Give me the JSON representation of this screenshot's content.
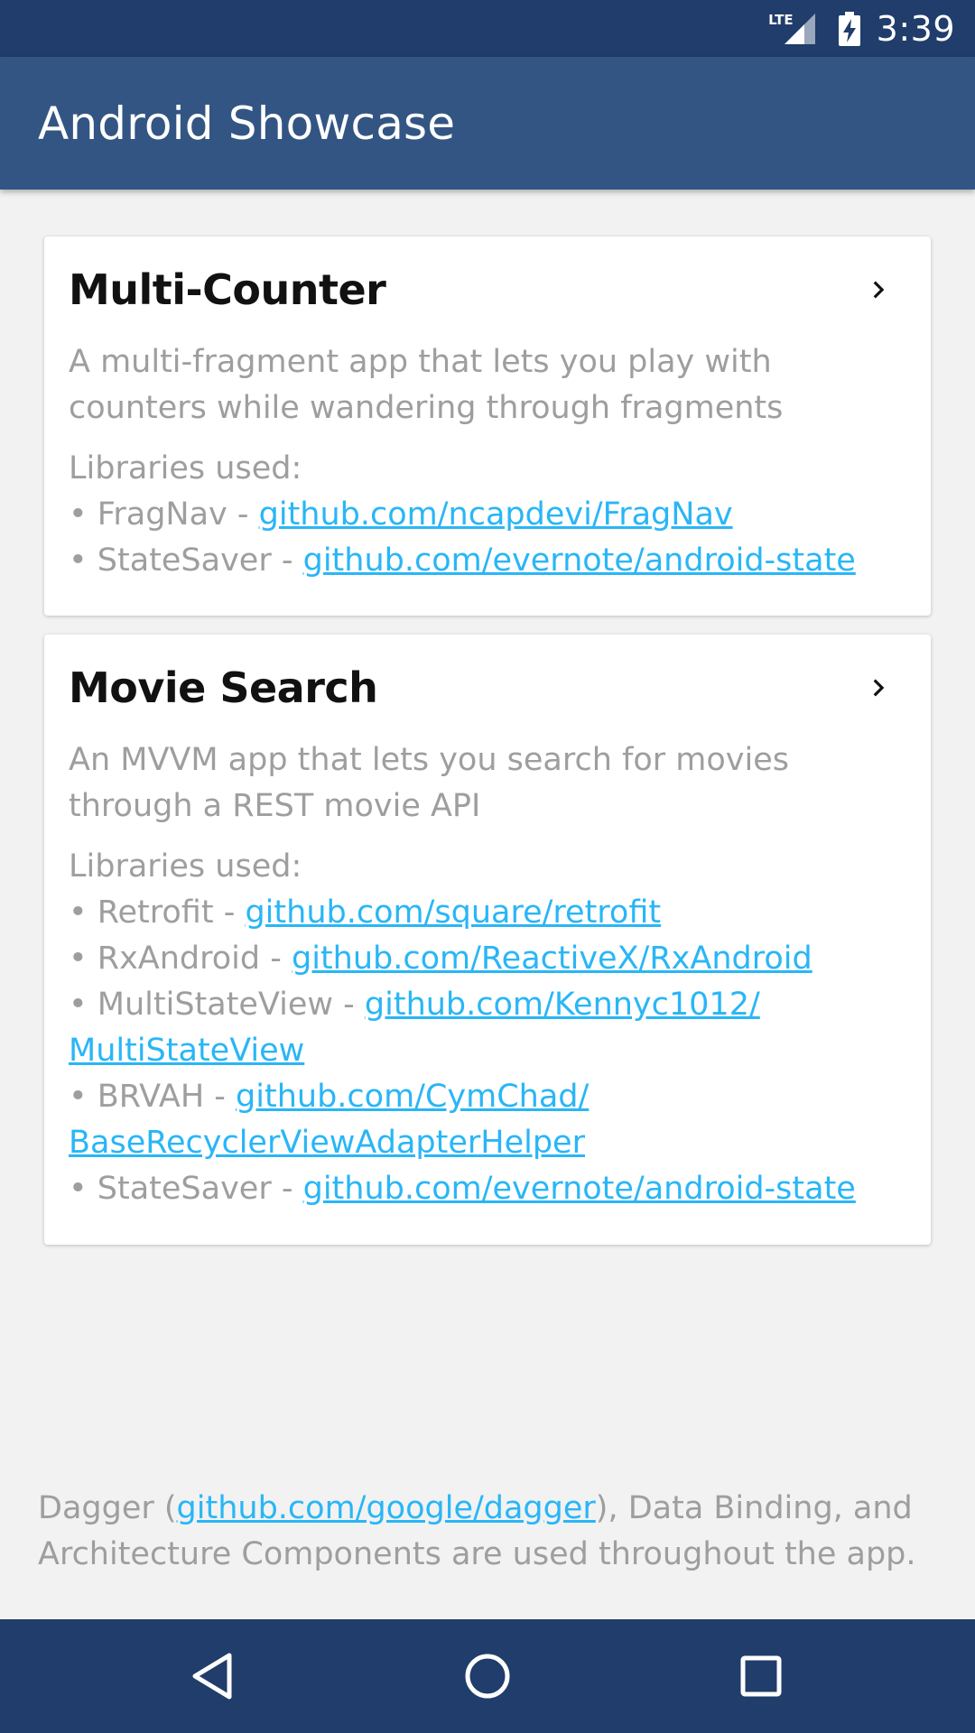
{
  "status_bar": {
    "network": "LTE",
    "time": "3:39",
    "icons": [
      "signal-icon",
      "battery-charging-icon"
    ]
  },
  "app_bar": {
    "title": "Android Showcase"
  },
  "cards": [
    {
      "title": "Multi-Counter",
      "description": "A multi-fragment app that lets you play with counters while wandering through fragments",
      "libs_header": "Libraries used:",
      "libs": [
        {
          "prefix": "• FragNav - ",
          "link": "github.com/ncapdevi/FragNav"
        },
        {
          "prefix": "• StateSaver - ",
          "link": "github.com/evernote/android-state"
        }
      ]
    },
    {
      "title": "Movie Search",
      "description": "An MVVM app that lets you search for movies through a REST movie API",
      "libs_header": "Libraries used:",
      "libs": [
        {
          "prefix": "• Retrofit - ",
          "link": "github.com/square/retrofit"
        },
        {
          "prefix": "• RxAndroid - ",
          "link": "github.com/ReactiveX/RxAndroid"
        },
        {
          "prefix": "• MultiStateView - ",
          "link": "github.com/Kennyc1012/",
          "link_cont": "MultiStateView"
        },
        {
          "prefix": "• BRVAH - ",
          "link": "github.com/CymChad/",
          "link_cont": "BaseRecyclerViewAdapterHelper"
        },
        {
          "prefix": "• StateSaver - ",
          "link": "github.com/evernote/android-state"
        }
      ]
    }
  ],
  "footer": {
    "before": "Dagger (",
    "link": "github.com/google/dagger",
    "after": "), Data Binding, and Architecture Components are used throughout the app."
  },
  "colors": {
    "status_bar": "#203d6b",
    "app_bar": "#335584",
    "link": "#29b6f6",
    "secondary_text": "#9e9e9e"
  },
  "nav_bar": {
    "buttons": [
      "back-icon",
      "home-icon",
      "recents-icon"
    ]
  }
}
